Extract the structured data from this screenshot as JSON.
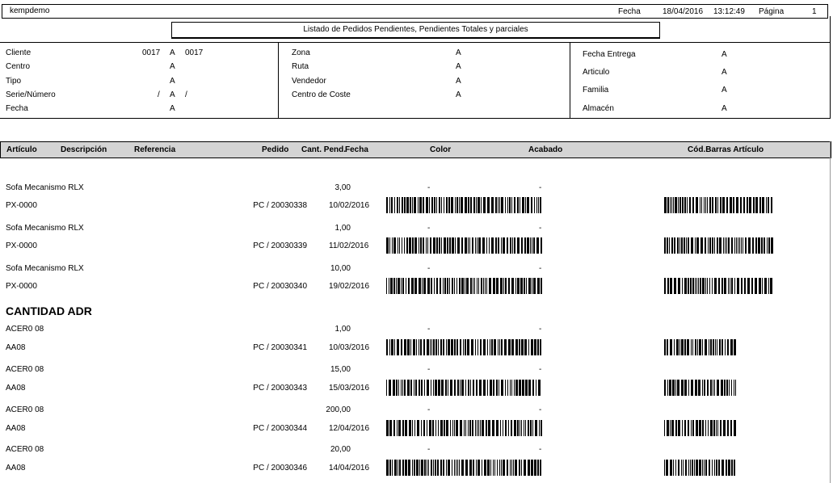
{
  "header": {
    "company": "kempdemo",
    "fecha_label": "Fecha",
    "fecha_value": "18/04/2016",
    "hora": "13:12:49",
    "pagina_label": "Página",
    "pagina_value": "1"
  },
  "title": "Listado de Pedidos Pendientes, Pendientes Totales y parciales",
  "filters": {
    "col1": [
      {
        "label": "Cliente",
        "from": "0017",
        "sep": "A",
        "to": "0017"
      },
      {
        "label": "Centro",
        "from": "",
        "sep": "A",
        "to": ""
      },
      {
        "label": "Tipo",
        "from": "",
        "sep": "A",
        "to": ""
      },
      {
        "label": "Serie/Número",
        "from": "/",
        "sep": "A",
        "to": "/"
      },
      {
        "label": "Fecha",
        "from": "",
        "sep": "A",
        "to": ""
      }
    ],
    "col2": [
      {
        "label": "Zona",
        "sep": "A"
      },
      {
        "label": "Ruta",
        "sep": "A"
      },
      {
        "label": "Vendedor",
        "sep": "A"
      },
      {
        "label": "Centro de Coste",
        "sep": "A"
      }
    ],
    "col3": [
      {
        "label": "Fecha Entrega",
        "sep": "A"
      },
      {
        "label": "Articulo",
        "sep": "A"
      },
      {
        "label": "Familia",
        "sep": "A"
      },
      {
        "label": "Almacén",
        "sep": "A"
      }
    ]
  },
  "columns": {
    "articulo": "Artículo",
    "descripcion": "Descripción",
    "referencia": "Referencia",
    "pedido": "Pedido",
    "cant_pend": "Cant. Pend.",
    "fecha": "Fecha",
    "color": "Color",
    "acabado": "Acabado",
    "codbarras": "Cód.Barras Artículo"
  },
  "section_title": "CANTIDAD ADR",
  "rows": [
    {
      "descripcion": "Sofa Mecanismo RLX",
      "articulo": "PX-0000",
      "pedido": "PC / 20030338",
      "cantidad": "3,00",
      "fecha": "10/02/2016",
      "color": "-",
      "acabado": "-"
    },
    {
      "descripcion": "Sofa Mecanismo RLX",
      "articulo": "PX-0000",
      "pedido": "PC / 20030339",
      "cantidad": "1,00",
      "fecha": "11/02/2016",
      "color": "-",
      "acabado": "-"
    },
    {
      "descripcion": "Sofa Mecanismo RLX",
      "articulo": "PX-0000",
      "pedido": "PC / 20030340",
      "cantidad": "10,00",
      "fecha": "19/02/2016",
      "color": "-",
      "acabado": "-"
    },
    {
      "descripcion": "ACER0 08",
      "articulo": "AA08",
      "pedido": "PC / 20030341",
      "cantidad": "1,00",
      "fecha": "10/03/2016",
      "color": "-",
      "acabado": "-"
    },
    {
      "descripcion": "ACER0 08",
      "articulo": "AA08",
      "pedido": "PC / 20030343",
      "cantidad": "15,00",
      "fecha": "15/03/2016",
      "color": "-",
      "acabado": "-"
    },
    {
      "descripcion": "ACER0 08",
      "articulo": "AA08",
      "pedido": "PC / 20030344",
      "cantidad": "200,00",
      "fecha": "12/04/2016",
      "color": "-",
      "acabado": "-"
    },
    {
      "descripcion": "ACER0 08",
      "articulo": "AA08",
      "pedido": "PC / 20030346",
      "cantidad": "20,00",
      "fecha": "14/04/2016",
      "color": "-",
      "acabado": "-"
    }
  ]
}
